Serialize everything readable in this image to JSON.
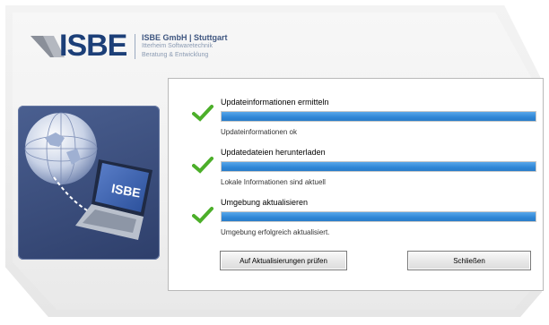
{
  "header": {
    "logo_text": "ISBE",
    "company_name": "ISBE GmbH | Stuttgart",
    "company_line1": "Itterheim Softwaretechnik",
    "company_line2": "Beratung & Entwicklung"
  },
  "illustration": {
    "laptop_screen_text": "ISBE"
  },
  "steps": [
    {
      "title": "Updateinformationen ermitteln",
      "status": "Updateinformationen ok",
      "progress": 1.0
    },
    {
      "title": "Updatedateien herunterladen",
      "status": "Lokale Informationen sind aktuell",
      "progress": 1.0
    },
    {
      "title": "Umgebung aktualisieren",
      "status": "Umgebung erfolgreich aktualisiert.",
      "progress": 1.0
    }
  ],
  "buttons": {
    "check_updates": "Auf Aktualisierungen prüfen",
    "close": "Schließen"
  },
  "colors": {
    "brand": "#1c3f78",
    "progress": "#2f86d6",
    "check": "#4caf2a"
  }
}
